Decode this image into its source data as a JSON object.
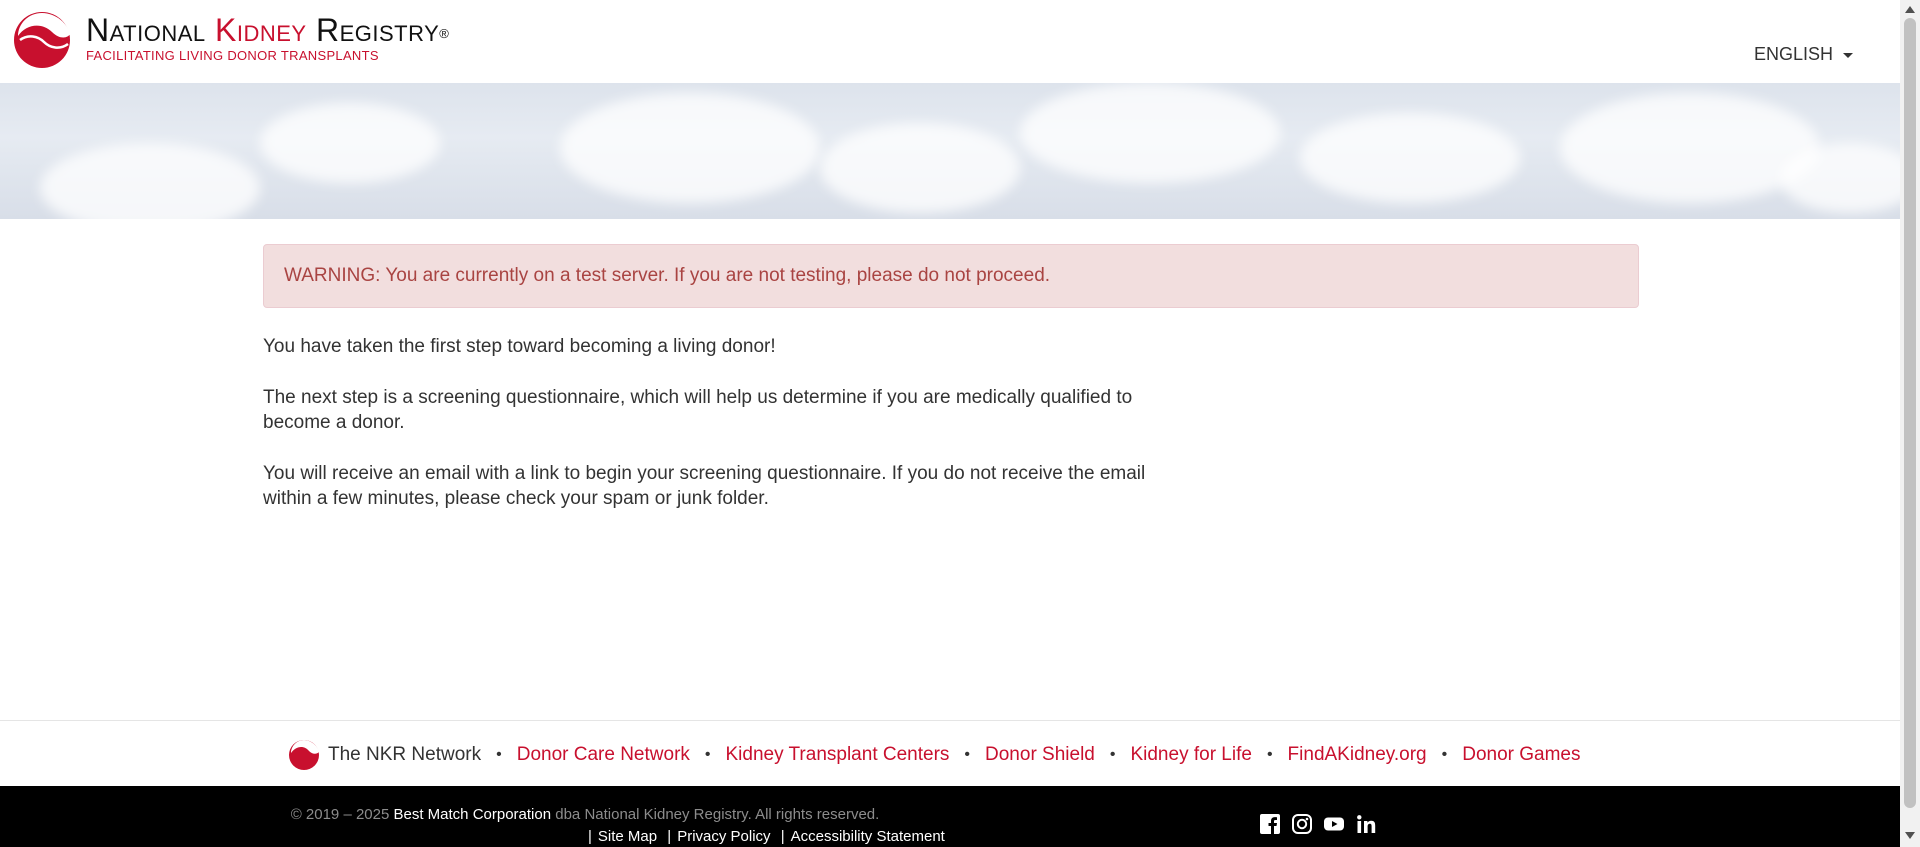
{
  "header": {
    "logo_title_part1": "National ",
    "logo_title_kidney": "Kidney",
    "logo_title_part2": " Registry",
    "logo_registered": "®",
    "logo_tagline": "FACILITATING LIVING DONOR TRANSPLANTS",
    "language": "ENGLISH"
  },
  "alert": {
    "text": "WARNING: You are currently on a test server. If you are not testing, please do not proceed."
  },
  "content": {
    "paragraphs": [
      "You have taken the first step toward becoming a living donor!",
      "The next step is a screening questionnaire, which will help us determine if you are medically qualified to become a donor.",
      "You will receive an email with a link to begin your screening questionnaire. If you do not receive the email within a few minutes, please check your spam or junk folder."
    ]
  },
  "network": {
    "label": "The NKR Network",
    "separator": "•",
    "links": [
      "Donor Care Network",
      "Kidney Transplant Centers",
      "Donor Shield",
      "Kidney for Life",
      "FindAKidney.org",
      "Donor Games"
    ]
  },
  "footer": {
    "copyright_prefix": "© 2019 – 2025 ",
    "company": "Best Match Corporation",
    "copyright_suffix": " dba National Kidney Registry. All rights reserved.",
    "separator": "|",
    "legal_links": [
      "Site Map",
      "Privacy Policy",
      "Accessibility Statement"
    ],
    "social_icons": [
      "facebook-icon",
      "instagram-icon",
      "youtube-icon",
      "linkedin-icon"
    ]
  },
  "colors": {
    "brand_red": "#c8102e",
    "alert_bg": "#f2dede",
    "alert_text": "#a94442",
    "footer_bg": "#000000"
  }
}
